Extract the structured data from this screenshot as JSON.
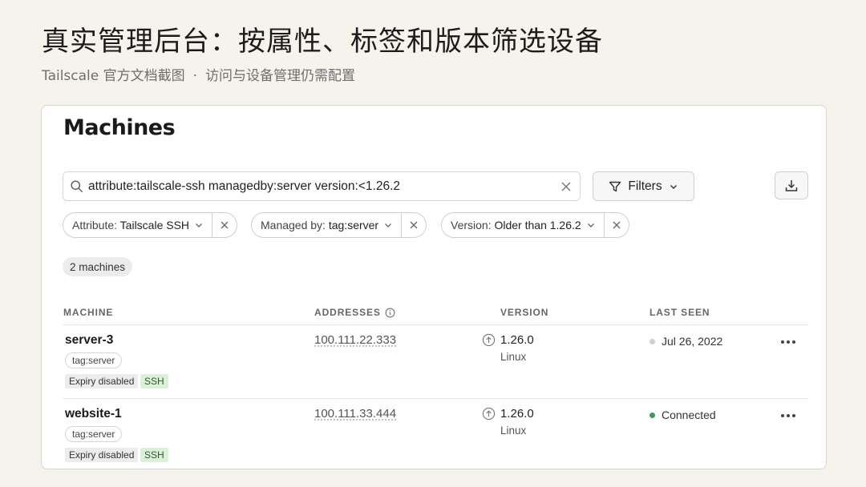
{
  "slide": {
    "title": "真实管理后台：按属性、标签和版本筛选设备",
    "subtitle_source": "Tailscale 官方文档截图",
    "subtitle_sep": "·",
    "subtitle_note": "访问与设备管理仍需配置"
  },
  "page": {
    "heading": "Machines"
  },
  "search": {
    "value": "attribute:tailscale-ssh managedby:server version:<1.26.2"
  },
  "toolbar": {
    "filters_label": "Filters"
  },
  "chips": [
    {
      "key": "Attribute:",
      "value": "Tailscale SSH"
    },
    {
      "key": "Managed by:",
      "value": "tag:server"
    },
    {
      "key": "Version:",
      "value": "Older than 1.26.2"
    }
  ],
  "result_count": "2 machines",
  "columns": {
    "machine": "MACHINE",
    "addresses": "ADDRESSES",
    "version": "VERSION",
    "last_seen": "LAST SEEN"
  },
  "machines": [
    {
      "name": "server-3",
      "tag": "tag:server",
      "badges": [
        "Expiry disabled",
        "SSH"
      ],
      "address": "100.111.22.333",
      "version": "1.26.0",
      "os": "Linux",
      "status": "Jul 26, 2022",
      "status_color": "#d0d0d0"
    },
    {
      "name": "website-1",
      "tag": "tag:server",
      "badges": [
        "Expiry disabled",
        "SSH"
      ],
      "address": "100.111.33.444",
      "version": "1.26.0",
      "os": "Linux",
      "status": "Connected",
      "status_color": "#3f9a5e"
    }
  ],
  "colors": {
    "background": "#f6f3ec",
    "connected": "#3f9a5e",
    "ssh_badge": "#dcf1d9"
  }
}
